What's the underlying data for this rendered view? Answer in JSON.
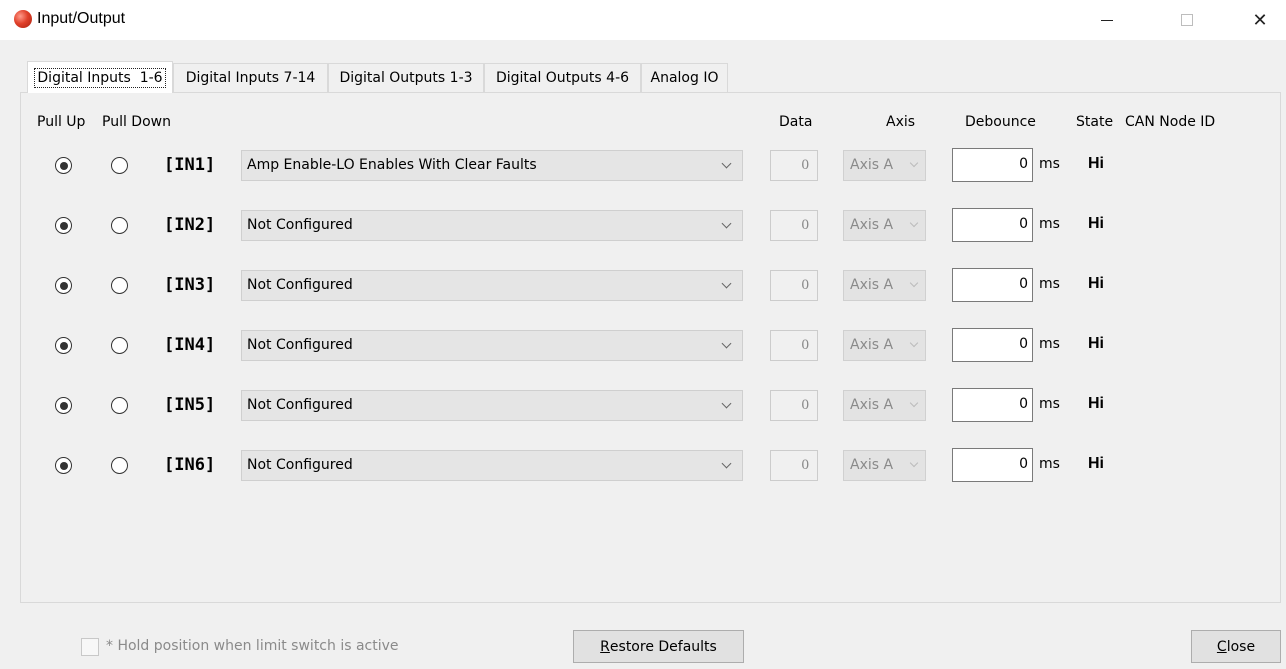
{
  "window": {
    "title": "Input/Output",
    "close_glyph": "✕"
  },
  "tabs": [
    {
      "label": "Digital Inputs  1-6",
      "active": true
    },
    {
      "label": "Digital Inputs 7-14",
      "active": false
    },
    {
      "label": "Digital Outputs 1-3",
      "active": false
    },
    {
      "label": "Digital Outputs 4-6",
      "active": false
    },
    {
      "label": "Analog IO",
      "active": false
    }
  ],
  "columns": {
    "pull_up": "Pull Up",
    "pull_down": "Pull Down",
    "data": "Data",
    "axis": "Axis",
    "debounce": "Debounce",
    "state": "State",
    "can_node_id": "CAN Node ID"
  },
  "inputs": [
    {
      "label": "[IN1]",
      "pull": "up",
      "function": "Amp Enable-LO Enables With Clear Faults",
      "data": "0",
      "axis": "Axis A",
      "debounce": "0",
      "unit": "ms",
      "state": "Hi"
    },
    {
      "label": "[IN2]",
      "pull": "up",
      "function": "Not Configured",
      "data": "0",
      "axis": "Axis A",
      "debounce": "0",
      "unit": "ms",
      "state": "Hi"
    },
    {
      "label": "[IN3]",
      "pull": "up",
      "function": "Not Configured",
      "data": "0",
      "axis": "Axis A",
      "debounce": "0",
      "unit": "ms",
      "state": "Hi"
    },
    {
      "label": "[IN4]",
      "pull": "up",
      "function": "Not Configured",
      "data": "0",
      "axis": "Axis A",
      "debounce": "0",
      "unit": "ms",
      "state": "Hi"
    },
    {
      "label": "[IN5]",
      "pull": "up",
      "function": "Not Configured",
      "data": "0",
      "axis": "Axis A",
      "debounce": "0",
      "unit": "ms",
      "state": "Hi"
    },
    {
      "label": "[IN6]",
      "pull": "up",
      "function": "Not Configured",
      "data": "0",
      "axis": "Axis A",
      "debounce": "0",
      "unit": "ms",
      "state": "Hi"
    }
  ],
  "footer": {
    "hold_checkbox_label": "* Hold position when limit switch is active",
    "hold_checked": false,
    "hold_enabled": false,
    "restore_prefix": "R",
    "restore_rest": "estore Defaults",
    "close_prefix": "C",
    "close_rest": "lose"
  }
}
